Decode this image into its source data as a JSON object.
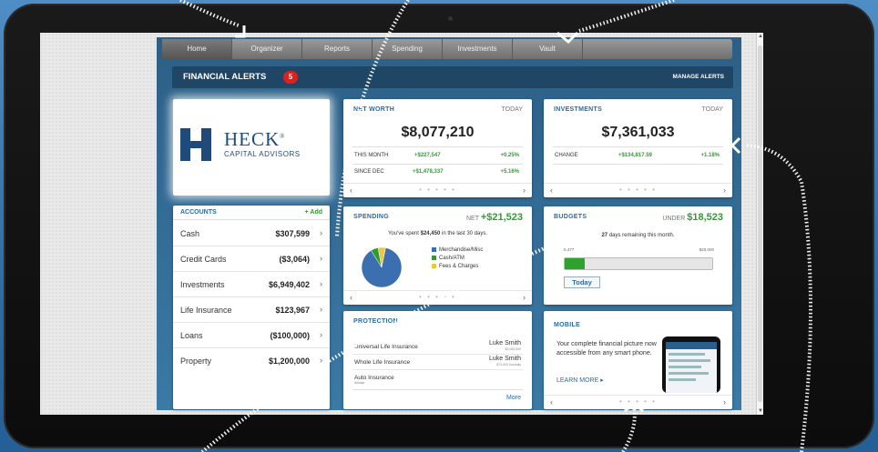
{
  "nav": {
    "items": [
      "Home",
      "Organizer",
      "Reports",
      "Spending",
      "Investments",
      "Vault",
      ""
    ],
    "active_index": 0
  },
  "alerts": {
    "title": "FINANCIAL ALERTS",
    "count": "5",
    "manage_label": "MANAGE ALERTS"
  },
  "brand": {
    "name": "HECK",
    "registered": "®",
    "subtitle": "CAPITAL ADVISORS"
  },
  "accounts": {
    "title": "ACCOUNTS",
    "add_label": "+ Add",
    "rows": [
      {
        "name": "Cash",
        "value": "$307,599"
      },
      {
        "name": "Credit Cards",
        "value": "($3,064)"
      },
      {
        "name": "Investments",
        "value": "$6,949,402"
      },
      {
        "name": "Life Insurance",
        "value": "$123,967"
      },
      {
        "name": "Loans",
        "value": "($100,000)"
      },
      {
        "name": "Property",
        "value": "$1,200,000"
      }
    ],
    "chevron": "›"
  },
  "net_worth": {
    "title": "NET WORTH",
    "when": "TODAY",
    "value": "$8,077,210",
    "rows": [
      {
        "label": "THIS MONTH",
        "amount": "+$227,547",
        "pct": "+0.25%"
      },
      {
        "label": "SINCE DEC",
        "amount": "+$1,478,337",
        "pct": "+5.16%"
      }
    ]
  },
  "investments": {
    "title": "INVESTMENTS",
    "when": "TODAY",
    "value": "$7,361,033",
    "change_label": "CHANGE",
    "change_amount": "+$134,817.59",
    "change_pct": "+1.18%"
  },
  "spending": {
    "title": "SPENDING",
    "net_label": "NET",
    "net_value": "+$21,523",
    "note_prefix": "You've spent",
    "note_amount": "$24,450",
    "note_suffix": "in the last 30 days.",
    "legend": [
      {
        "label": "Merchandise/Misc",
        "color": "#3b6fb0",
        "share": 0.88
      },
      {
        "label": "Cash/ATM",
        "color": "#2e9d2e",
        "share": 0.06
      },
      {
        "label": "Fees & Charges",
        "color": "#e8c74a",
        "share": 0.06
      }
    ]
  },
  "budgets": {
    "title": "BUDGETS",
    "under_label": "UNDER",
    "under_value": "$18,523",
    "days_num": "27",
    "days_text": "days remaining this month.",
    "bar_left": "5,477",
    "bar_right": "$20,000",
    "progress": 0.135,
    "today_label": "Today"
  },
  "protection": {
    "title": "PROTECTION",
    "rows": [
      {
        "name": "Universal Life Insurance",
        "person": "Luke Smith",
        "detail": "$2,000,000",
        "sub": ""
      },
      {
        "name": "Whole Life Insurance",
        "person": "Luke Smith",
        "detail": "$70,000 Annually",
        "sub": ""
      },
      {
        "name": "Auto Insurance",
        "person": "",
        "detail": "",
        "sub": "Allstate"
      }
    ],
    "more_label": "More"
  },
  "mobile": {
    "title": "MOBILE",
    "text": "Your complete financial picture now accessible from any smart phone.",
    "learn_more": "LEARN MORE ▸"
  },
  "pager": {
    "prev": "‹",
    "next": "›",
    "dots": "• • • • •"
  },
  "colors": {
    "accent": "#2a6aa3",
    "positive": "#2e9d2e",
    "badge": "#e0201e"
  }
}
